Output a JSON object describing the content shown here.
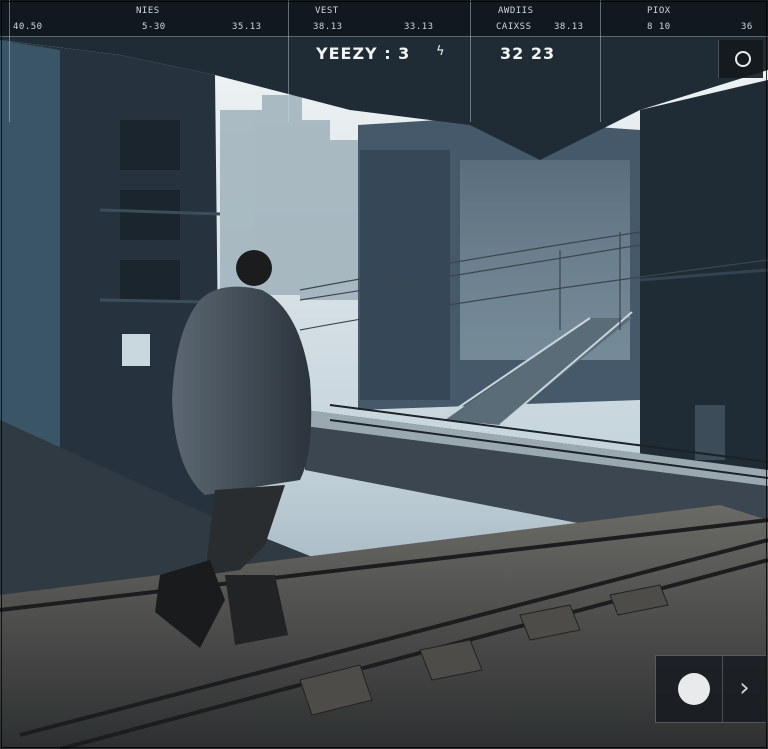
{
  "hud": {
    "columns": [
      {
        "head": "NIES",
        "value": "5-30"
      },
      {
        "head": "VEST",
        "value": "38.13"
      },
      {
        "head": "AWDIIS",
        "value": "CAIXSS"
      },
      {
        "head": "PIOX",
        "value": "8 10"
      }
    ],
    "left_readout": "40.50",
    "mid_readout": "35.13",
    "right_readout_a": "33.13",
    "right_readout_b": "36",
    "title": "YEEZY : 3",
    "counter": "32  23",
    "bolt_icon": "lightning-icon",
    "corner_icon": "ring-icon"
  },
  "controls": {
    "record_icon": "record-circle-icon",
    "next_icon": "chevron-right-icon",
    "next_glyph": "›"
  },
  "colors": {
    "sky": "#dde6ea",
    "fog": "#8fa4b0",
    "building": "#22303c",
    "hoodie": "#3f4850",
    "rail": "#2a2e31"
  }
}
